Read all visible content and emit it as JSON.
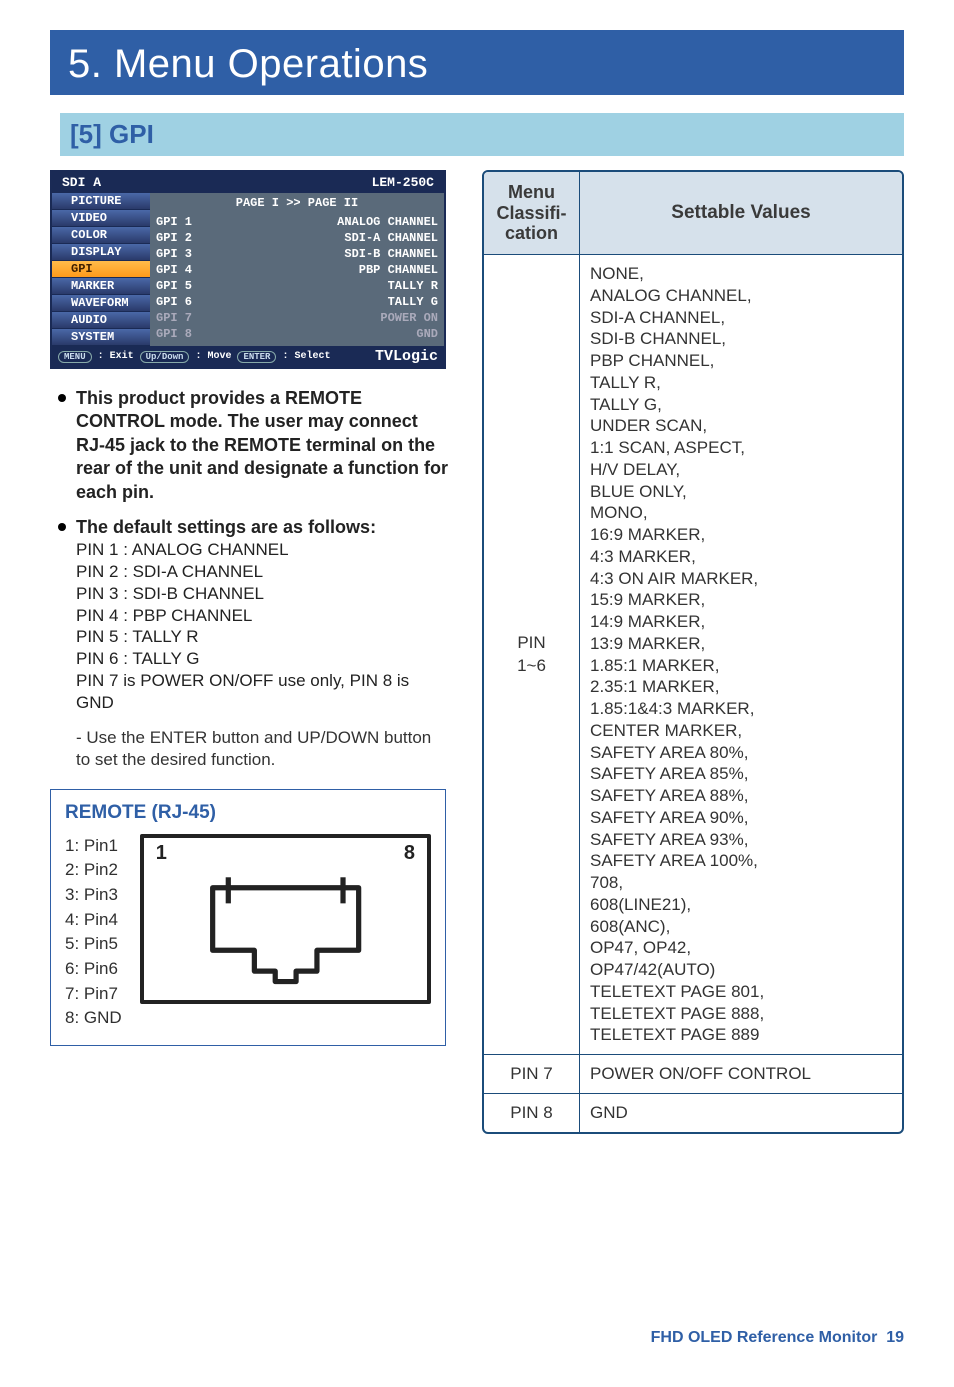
{
  "chapter_title": "5. Menu Operations",
  "section_title": "[5] GPI",
  "osd": {
    "top_left": "SDI A",
    "top_right": "LEM-250C",
    "menu_items": [
      "PICTURE",
      "VIDEO",
      "COLOR",
      "DISPLAY",
      "GPI",
      "MARKER",
      "WAVEFORM",
      "AUDIO",
      "SYSTEM"
    ],
    "selected_index": 4,
    "page_label": "PAGE I >> PAGE II",
    "rows": [
      {
        "l": "GPI 1",
        "r": "ANALOG CHANNEL",
        "dim": false
      },
      {
        "l": "GPI 2",
        "r": "SDI-A CHANNEL",
        "dim": false
      },
      {
        "l": "GPI 3",
        "r": "SDI-B CHANNEL",
        "dim": false
      },
      {
        "l": "GPI 4",
        "r": "PBP CHANNEL",
        "dim": false
      },
      {
        "l": "GPI 5",
        "r": "TALLY R",
        "dim": false
      },
      {
        "l": "GPI 6",
        "r": "TALLY G",
        "dim": false
      },
      {
        "l": "GPI 7",
        "r": "POWER ON",
        "dim": true
      },
      {
        "l": "GPI 8",
        "r": "GND",
        "dim": true
      }
    ],
    "bottom": {
      "b1_tag": "MENU",
      "b1_txt": ": Exit",
      "b2_tag": "Up/Down",
      "b2_txt": ": Move",
      "b3_tag": "ENTER",
      "b3_txt": ": Select",
      "brand": "TVLogic"
    }
  },
  "bullets": {
    "p1_head": "This product provides a REMOTE CONTROL mode. The user may connect RJ-45 jack to the REMOTE terminal on the rear of the unit and designate a function for each pin.",
    "p2_head": "The default settings are as follows:",
    "p2_lines": "PIN 1 : ANALOG CHANNEL\nPIN 2 : SDI-A CHANNEL\nPIN 3 : SDI-B CHANNEL\nPIN 4 : PBP CHANNEL\nPIN 5 : TALLY R\nPIN 6 : TALLY G\nPIN 7 is POWER ON/OFF use only, PIN 8 is GND",
    "p2_note": "- Use the ENTER button and UP/DOWN button\n  to set the desired function."
  },
  "rj45": {
    "title": "REMOTE (RJ-45)",
    "pins": [
      "1: Pin1",
      "2: Pin2",
      "3: Pin3",
      "4: Pin4",
      "5: Pin5",
      "6: Pin6",
      "7: Pin7",
      "8: GND"
    ],
    "fig_left": "1",
    "fig_right": "8"
  },
  "table": {
    "h1": "Menu Classifi­cation",
    "h2": "Settable Values",
    "rows": [
      {
        "c1": "PIN\n1~6",
        "c2": "NONE,\nANALOG CHANNEL,\nSDI-A CHANNEL,\nSDI-B CHANNEL,\nPBP CHANNEL,\nTALLY R,\nTALLY G,\nUNDER SCAN,\n1:1 SCAN, ASPECT,\nH/V DELAY,\nBLUE ONLY,\nMONO,\n16:9 MARKER,\n4:3 MARKER,\n4:3 ON AIR MARKER,\n15:9 MARKER,\n14:9 MARKER,\n13:9 MARKER,\n1.85:1 MARKER,\n2.35:1 MARKER,\n1.85:1&4:3 MARKER,\nCENTER MARKER,\nSAFETY AREA 80%,\nSAFETY AREA 85%,\nSAFETY AREA 88%,\nSAFETY AREA 90%,\nSAFETY AREA 93%,\nSAFETY AREA 100%,\n708,\n608(LINE21),\n608(ANC),\nOP47, OP42,\nOP47/42(AUTO)\nTELETEXT PAGE 801,\nTELETEXT PAGE 888,\nTELETEXT PAGE 889"
      },
      {
        "c1": "PIN 7",
        "c2": "POWER ON/OFF CONTROL"
      },
      {
        "c1": "PIN 8",
        "c2": "GND"
      }
    ]
  },
  "footer": {
    "text": "FHD OLED Reference Monitor",
    "page": "19"
  }
}
